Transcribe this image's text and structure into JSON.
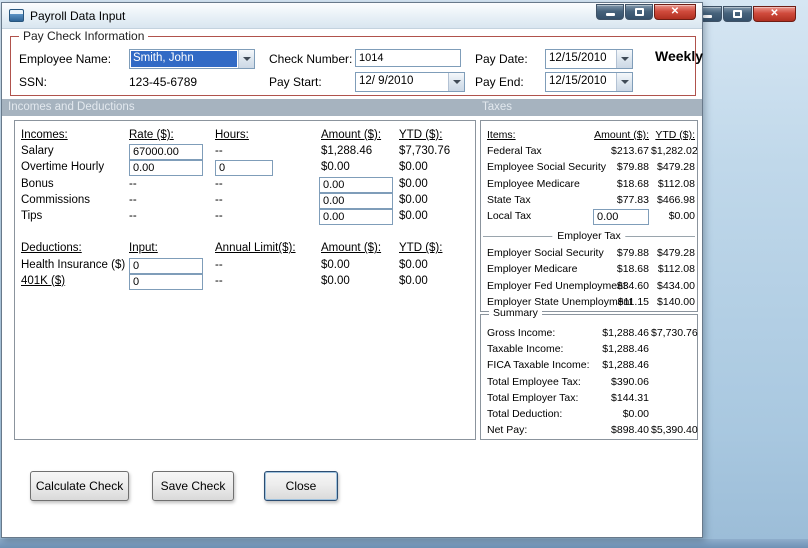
{
  "icons": {
    "close": "✕"
  },
  "window": {
    "title": "Payroll Data Input"
  },
  "paycheck": {
    "group_title": "Pay Check Information",
    "employee_name": {
      "label": "Employee Name:",
      "value": "Smith, John"
    },
    "ssn": {
      "label": "SSN:",
      "value": "123-45-6789"
    },
    "check_number": {
      "label": "Check Number:",
      "value": "1014"
    },
    "pay_start": {
      "label": "Pay Start:",
      "value": "12/ 9/2010"
    },
    "pay_date": {
      "label": "Pay Date:",
      "value": "12/15/2010"
    },
    "pay_end": {
      "label": "Pay End:",
      "value": "12/15/2010"
    },
    "frequency": "Weekly"
  },
  "section_headers": {
    "left": "Incomes and Deductions",
    "right": "Taxes"
  },
  "incomes": {
    "headers": {
      "item": "Incomes:",
      "rate": "Rate ($):",
      "hours": "Hours:",
      "amount": "Amount ($):",
      "ytd": "YTD ($):"
    },
    "salary": {
      "label": "Salary",
      "rate": "67000.00",
      "hours": "--",
      "amount": "$1,288.46",
      "ytd": "$7,730.76"
    },
    "overtime": {
      "label": "Overtime Hourly",
      "rate": "0.00",
      "hours": "0",
      "amount": "$0.00",
      "ytd": "$0.00"
    },
    "bonus": {
      "label": "Bonus",
      "rate": "--",
      "hours": "--",
      "amount": "0.00",
      "ytd": "$0.00"
    },
    "commissions": {
      "label": "Commissions",
      "rate": "--",
      "hours": "--",
      "amount": "0.00",
      "ytd": "$0.00"
    },
    "tips": {
      "label": "Tips",
      "rate": "--",
      "hours": "--",
      "amount": "0.00",
      "ytd": "$0.00"
    }
  },
  "deductions": {
    "headers": {
      "item": "Deductions:",
      "input": "Input:",
      "limit": "Annual Limit($):",
      "amount": "Amount ($):",
      "ytd": "YTD ($):"
    },
    "health": {
      "label": "Health Insurance  ($)",
      "input": "0",
      "limit": "--",
      "amount": "$0.00",
      "ytd": "$0.00"
    },
    "k401": {
      "label": "401K  ($)",
      "input": "0",
      "limit": "--",
      "amount": "$0.00",
      "ytd": "$0.00"
    }
  },
  "taxes": {
    "headers": {
      "item": "Items:",
      "amount": "Amount ($):",
      "ytd": "YTD ($):"
    },
    "federal": {
      "label": "Federal Tax",
      "amount": "$213.67",
      "ytd": "$1,282.02"
    },
    "emp_ss": {
      "label": "Employee Social Security",
      "amount": "$79.88",
      "ytd": "$479.28"
    },
    "emp_medicare": {
      "label": "Employee Medicare",
      "amount": "$18.68",
      "ytd": "$112.08"
    },
    "state": {
      "label": "State Tax",
      "amount": "$77.83",
      "ytd": "$466.98"
    },
    "local": {
      "label": "Local Tax",
      "amount": "0.00",
      "ytd": "$0.00"
    },
    "employer_group": "Employer Tax",
    "er_ss": {
      "label": "Employer Social Security",
      "amount": "$79.88",
      "ytd": "$479.28"
    },
    "er_medicare": {
      "label": "Employer Medicare",
      "amount": "$18.68",
      "ytd": "$112.08"
    },
    "er_fed_unemp": {
      "label": "Employer Fed Unemployment",
      "amount": "$34.60",
      "ytd": "$434.00"
    },
    "er_state_unemp": {
      "label": "Employer State Unemployment",
      "amount": "$11.15",
      "ytd": "$140.00"
    }
  },
  "summary": {
    "title": "Summary",
    "gross": {
      "label": "Gross Income:",
      "v1": "$1,288.46",
      "v2": "$7,730.76"
    },
    "taxable": {
      "label": "Taxable Income:",
      "v1": "$1,288.46"
    },
    "fica": {
      "label": "FICA Taxable Income:",
      "v1": "$1,288.46"
    },
    "total_employee_tax": {
      "label": "Total Employee Tax:",
      "v1": "$390.06"
    },
    "total_employer_tax": {
      "label": "Total Employer Tax:",
      "v1": "$144.31"
    },
    "total_deduction": {
      "label": "Total Deduction:",
      "v1": "$0.00"
    },
    "net_pay": {
      "label": "Net Pay:",
      "v1": "$898.40",
      "v2": "$5,390.40"
    }
  },
  "buttons": {
    "calculate": "Calculate Check",
    "save": "Save Check",
    "close": "Close"
  }
}
